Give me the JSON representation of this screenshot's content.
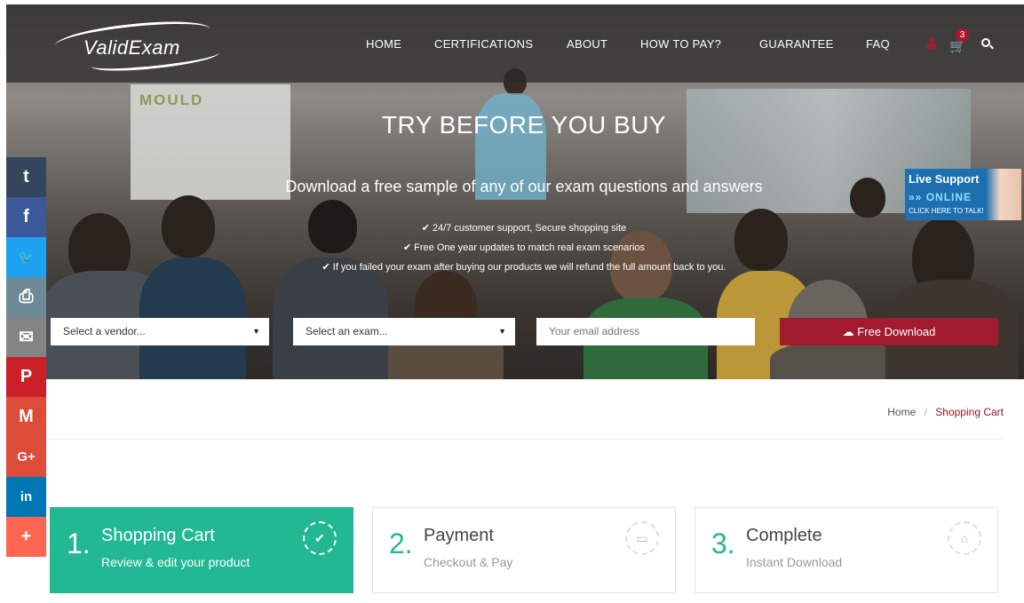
{
  "brand": {
    "name": "ValidExam"
  },
  "nav": {
    "items": [
      "HOME",
      "CERTIFICATIONS",
      "ABOUT",
      "HOW TO PAY?",
      "GUARANTEE",
      "FAQ"
    ],
    "cart_count": "3"
  },
  "hero": {
    "title": "TRY BEFORE YOU BUY",
    "subtitle": "Download a free sample of any of our exam questions and answers",
    "bullets": [
      "24/7 customer support, Secure shopping site",
      "Free One year updates to match real exam scenarios",
      "If you failed your exam after buying our products we will refund the full amount back to you."
    ],
    "background_sign": "MOULD"
  },
  "download_form": {
    "vendor_select": "Select a vendor...",
    "exam_select": "Select an exam...",
    "email_placeholder": "Your email address",
    "button_label": "Free Download"
  },
  "live_support": {
    "title": "Live Support",
    "status": "ONLINE",
    "cta": "CLICK HERE TO TALK!"
  },
  "social": [
    {
      "name": "tumblr",
      "glyph": "t",
      "color": "#35465c"
    },
    {
      "name": "facebook",
      "glyph": "f",
      "color": "#3b5998"
    },
    {
      "name": "twitter",
      "glyph": "🐦",
      "color": "#1da1f2"
    },
    {
      "name": "print",
      "glyph": "⎙",
      "color": "#6d8a96"
    },
    {
      "name": "email",
      "glyph": "✉",
      "color": "#848484"
    },
    {
      "name": "pinterest",
      "glyph": "P",
      "color": "#cb2027"
    },
    {
      "name": "gmail",
      "glyph": "M",
      "color": "#dd4b39"
    },
    {
      "name": "google-plus",
      "glyph": "G+",
      "color": "#dd4b39"
    },
    {
      "name": "linkedin",
      "glyph": "in",
      "color": "#0077b5"
    },
    {
      "name": "more",
      "glyph": "+",
      "color": "#ff6550"
    }
  ],
  "breadcrumb": {
    "home": "Home",
    "separator": "/",
    "current": "Shopping Cart"
  },
  "steps": [
    {
      "num": "1",
      "title": "Shopping Cart",
      "desc": "Review & edit your product",
      "icon": "check-icon"
    },
    {
      "num": "2",
      "title": "Payment",
      "desc": "Checkout & Pay",
      "icon": "credit-card-icon"
    },
    {
      "num": "3",
      "title": "Complete",
      "desc": "Instant Download",
      "icon": "home-icon"
    }
  ],
  "colors": {
    "accent": "#22b893",
    "brand_red": "#a11a2e"
  }
}
